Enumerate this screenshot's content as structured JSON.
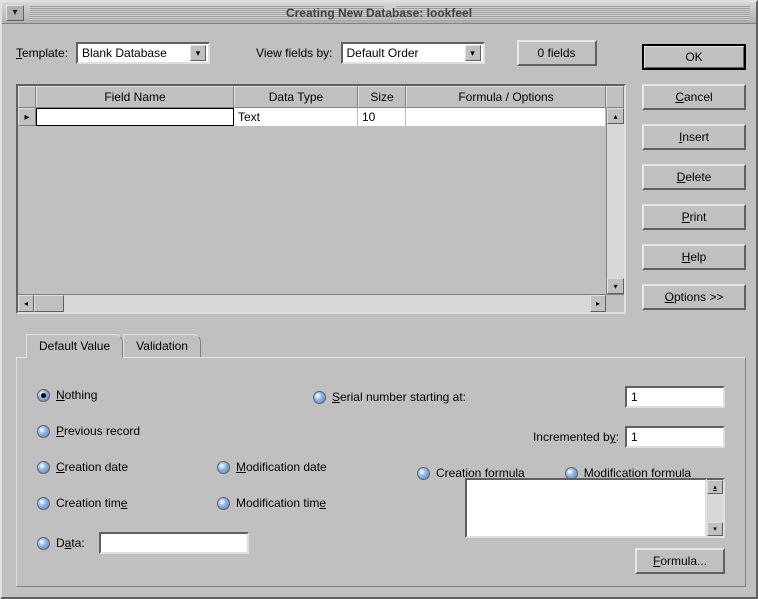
{
  "title": "Creating New Database: lookfeel",
  "top": {
    "template_label": "Template:",
    "template_value": "Blank Database",
    "view_label": "View fields by:",
    "view_value": "Default Order",
    "fields_button": "0 fields"
  },
  "buttons": {
    "ok": "OK",
    "cancel": "Cancel",
    "insert": "Insert",
    "delete": "Delete",
    "print": "Print",
    "help": "Help",
    "options": "Options >>"
  },
  "table": {
    "headers": {
      "field_name": "Field Name",
      "data_type": "Data Type",
      "size": "Size",
      "formula": "Formula / Options"
    },
    "rows": [
      {
        "field_name": "",
        "data_type": "Text",
        "size": "10",
        "formula": ""
      }
    ]
  },
  "tabs": {
    "default_value": "Default Value",
    "validation": "Validation"
  },
  "defaults": {
    "nothing": "Nothing",
    "previous_record": "Previous record",
    "creation_date": "Creation date",
    "creation_time": "Creation time",
    "modification_date": "Modification date",
    "modification_time": "Modification time",
    "data": "Data:",
    "data_value": "",
    "serial_label": "Serial number starting at:",
    "serial_value": "1",
    "incremented_label": "Incremented by:",
    "incremented_value": "1",
    "creation_formula": "Creation formula",
    "modification_formula": "Modification formula",
    "formula_value": "",
    "formula_button": "Formula..."
  }
}
